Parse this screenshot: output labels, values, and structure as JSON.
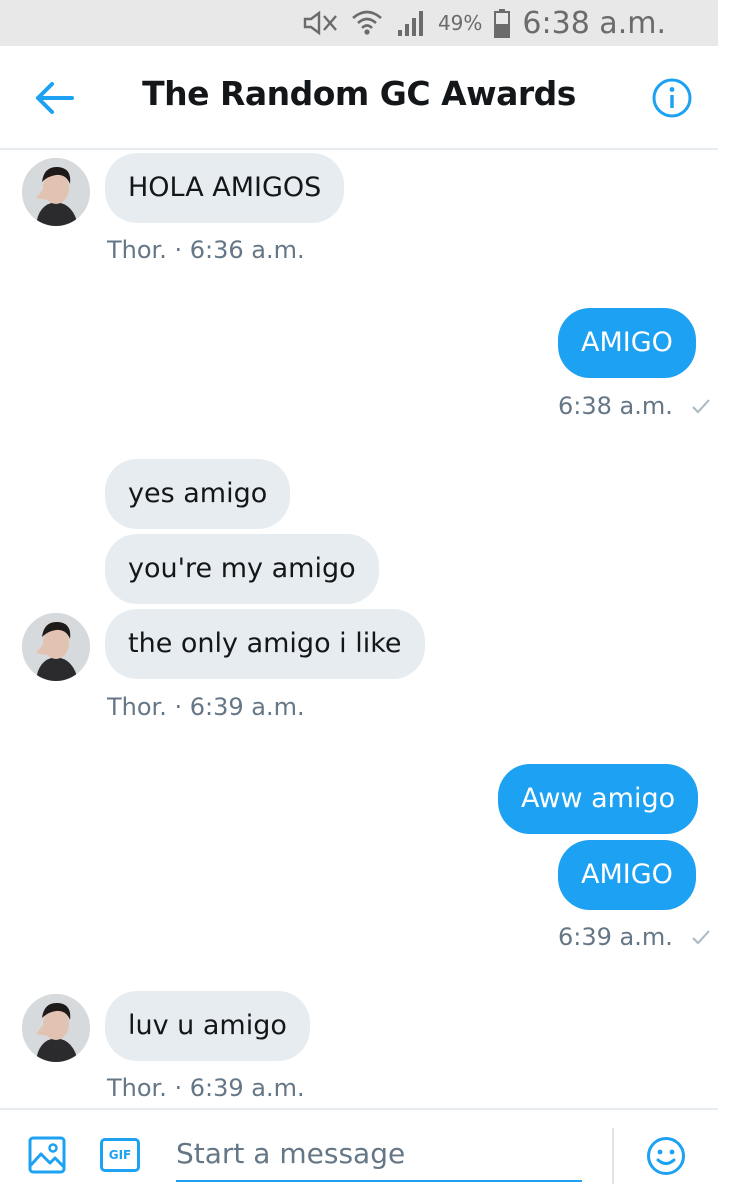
{
  "status_bar": {
    "battery_pct": "49%",
    "time": "6:38 a.m.",
    "icons": [
      "mute-icon",
      "wifi-icon",
      "signal-icon",
      "battery-icon"
    ]
  },
  "header": {
    "title": "The Random GC Awards",
    "back_icon": "arrow-left-icon",
    "info_icon": "info-icon"
  },
  "messages": [
    {
      "side": "in",
      "text": "HOLA AMIGOS"
    },
    {
      "side": "in_meta",
      "text": "Thor. · 6:36 a.m."
    },
    {
      "side": "out",
      "text": "AMIGO"
    },
    {
      "side": "out_meta",
      "text": "6:38 a.m."
    },
    {
      "side": "in",
      "text": "yes amigo"
    },
    {
      "side": "in",
      "text": "you're my amigo"
    },
    {
      "side": "in",
      "text": "the only amigo i like"
    },
    {
      "side": "in_meta",
      "text": "Thor. · 6:39 a.m."
    },
    {
      "side": "out",
      "text": "Aww amigo"
    },
    {
      "side": "out",
      "text": "AMIGO"
    },
    {
      "side": "out_meta",
      "text": "6:39 a.m."
    },
    {
      "side": "in",
      "text": "luv u amigo"
    },
    {
      "side": "in_meta",
      "text": "Thor. · 6:39 a.m."
    }
  ],
  "composer": {
    "placeholder": "Start a message",
    "gif_label": "GIF",
    "image_icon": "image-icon",
    "emoji_icon": "emoji-icon"
  },
  "colors": {
    "accent": "#1da1f2",
    "incoming_bubble": "#e6ecf0",
    "meta_text": "#657786"
  }
}
